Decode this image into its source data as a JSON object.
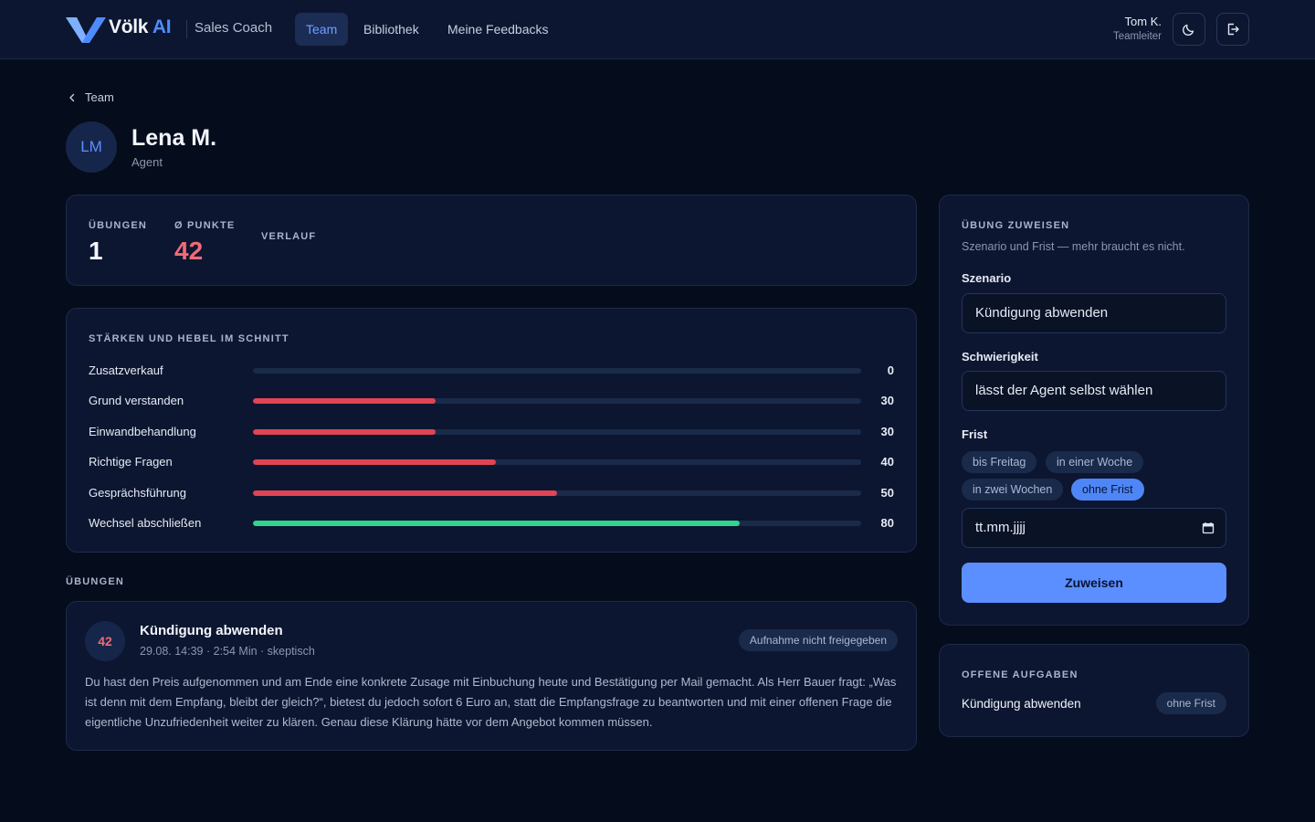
{
  "header": {
    "brand_name": "Völk",
    "brand_suffix": "AI",
    "app_name": "Sales Coach",
    "tabs": [
      {
        "label": "Team",
        "active": true
      },
      {
        "label": "Bibliothek",
        "active": false
      },
      {
        "label": "Meine Feedbacks",
        "active": false
      }
    ],
    "user": {
      "name": "Tom K.",
      "role": "Teamleiter"
    },
    "icons": [
      "moon-icon",
      "logout-icon"
    ]
  },
  "breadcrumb": {
    "back_label": "Team"
  },
  "profile": {
    "initials": "LM",
    "name": "Lena M.",
    "role": "Agent"
  },
  "stats": {
    "ubungen_label": "Übungen",
    "ubungen_value": "1",
    "punkte_label": "Ø Punkte",
    "punkte_value": "42",
    "verlauf_label": "Verlauf"
  },
  "strengths": {
    "title": "Stärken und Hebel im Schnitt",
    "items": [
      {
        "label": "Zusatzverkauf",
        "value": 0,
        "color": "#e04555"
      },
      {
        "label": "Grund verstanden",
        "value": 30,
        "color": "#e04555"
      },
      {
        "label": "Einwandbehandlung",
        "value": 30,
        "color": "#e04555"
      },
      {
        "label": "Richtige Fragen",
        "value": 40,
        "color": "#e04555"
      },
      {
        "label": "Gesprächsführung",
        "value": 50,
        "color": "#e04555"
      },
      {
        "label": "Wechsel abschließen",
        "value": 80,
        "color": "#2fd58f"
      }
    ]
  },
  "exercises": {
    "section_title": "Übungen",
    "items": [
      {
        "score": "42",
        "title": "Kündigung abwenden",
        "meta": "29.08. 14:39 · 2:54 Min · skeptisch",
        "badge": "Aufnahme nicht freigegeben",
        "feedback": "Du hast den Preis aufgenommen und am Ende eine konkrete Zusage mit Einbuchung heute und Bestätigung per Mail gemacht. Als Herr Bauer fragt: „Was ist denn mit dem Empfang, bleibt der gleich?“, bietest du jedoch sofort 6 Euro an, statt die Empfangsfrage zu beantworten und mit einer offenen Frage die eigentliche Unzufriedenheit weiter zu klären. Genau diese Klärung hätte vor dem Angebot kommen müssen."
      }
    ]
  },
  "assign": {
    "title": "Übung zuweisen",
    "subtitle": "Szenario und Frist — mehr braucht es nicht.",
    "scenario_label": "Szenario",
    "scenario_value": "Kündigung abwenden",
    "difficulty_label": "Schwierigkeit",
    "difficulty_value": "lässt der Agent selbst wählen",
    "deadline_label": "Frist",
    "deadline_options": [
      {
        "label": "bis Freitag",
        "selected": false
      },
      {
        "label": "in einer Woche",
        "selected": false
      },
      {
        "label": "in zwei Wochen",
        "selected": false
      },
      {
        "label": "ohne Frist",
        "selected": true
      }
    ],
    "date_placeholder": "tt.mm.jjjj",
    "submit_label": "Zuweisen"
  },
  "open_tasks": {
    "title": "Offene Aufgaben",
    "items": [
      {
        "label": "Kündigung abwenden",
        "badge": "ohne Frist"
      }
    ]
  },
  "colors": {
    "accent": "#5b8fff",
    "danger": "#e04555",
    "success": "#2fd58f",
    "score_text": "#f06b75"
  }
}
